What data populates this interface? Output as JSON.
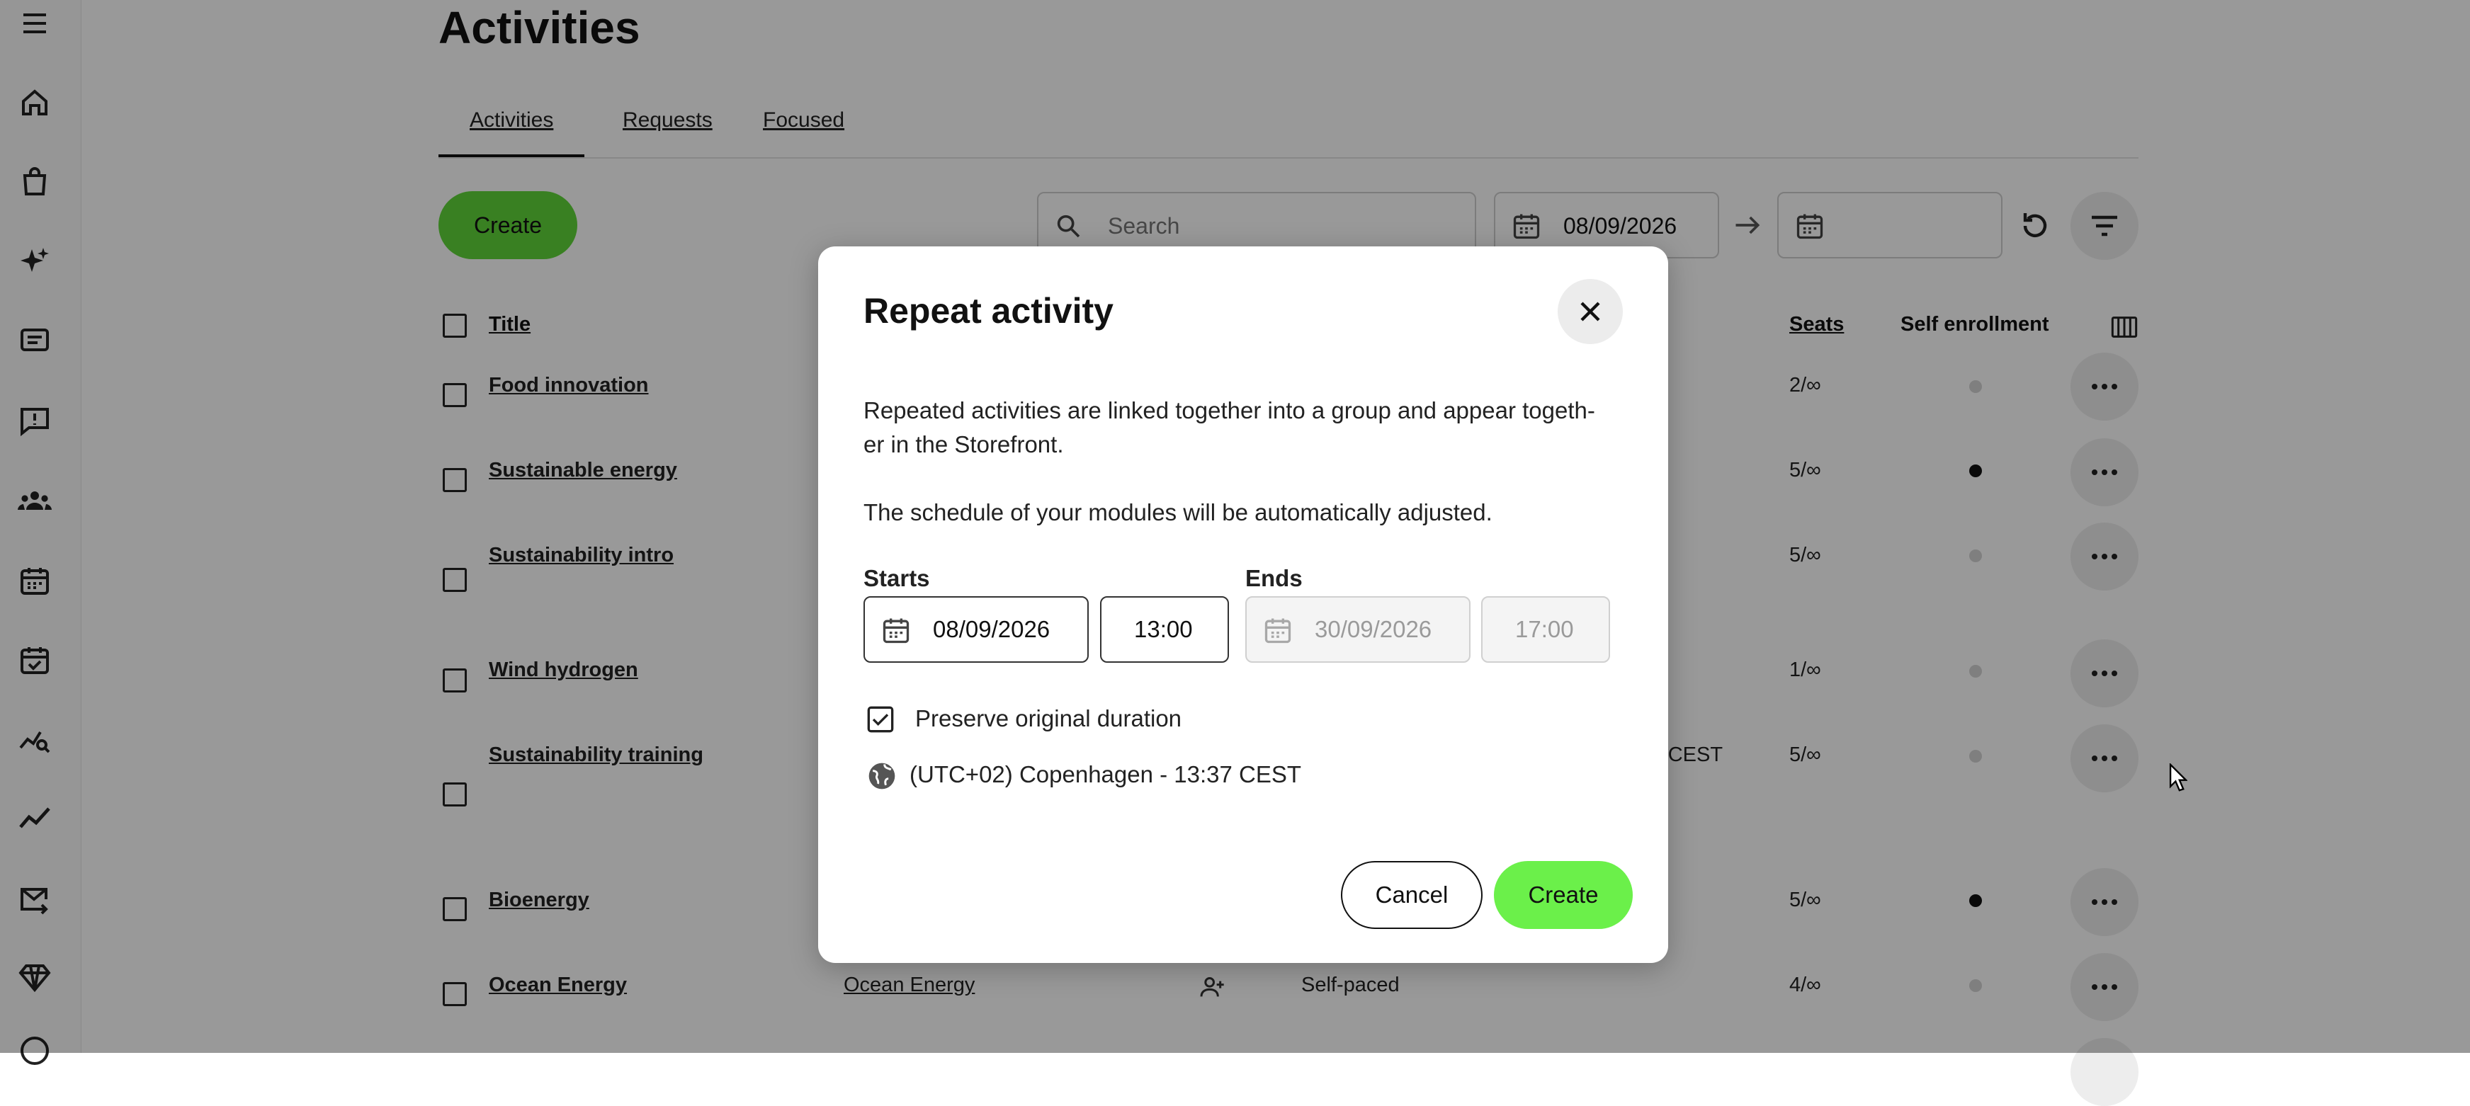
{
  "page": {
    "title": "Activities",
    "tabs": [
      {
        "label": "Activities",
        "active": true
      },
      {
        "label": "Requests",
        "active": false
      },
      {
        "label": "Focused",
        "active": false
      }
    ],
    "create_label": "Create",
    "search_placeholder": "Search",
    "date_from": "08/09/2026",
    "date_to": ""
  },
  "table": {
    "headers": {
      "title": "Title",
      "seats": "Seats",
      "self_enrollment": "Self enrollment"
    },
    "rows": [
      {
        "title": "Food innovation",
        "seats": "2/∞",
        "self_enrollment": false
      },
      {
        "title": "Sustainable energy",
        "seats": "5/∞",
        "self_enrollment": true
      },
      {
        "title": "Sustainability intro",
        "seats": "5/∞",
        "self_enrollment": false
      },
      {
        "title": "Wind hydrogen",
        "seats": "1/∞",
        "self_enrollment": false
      },
      {
        "title": "Sustainability training",
        "seats": "5/∞",
        "self_enrollment": false,
        "partial_text": ") CEST"
      },
      {
        "title": "Bioenergy",
        "seats": "5/∞",
        "self_enrollment": true
      },
      {
        "title": "Ocean Energy",
        "seats": "4/∞",
        "self_enrollment": false,
        "course": "Ocean Energy",
        "type": "Self-paced"
      }
    ]
  },
  "dialog": {
    "title": "Repeat activity",
    "description_1": "Repeated activities are linked together into a group and appear togeth-",
    "description_1b": "er in the Storefront.",
    "description_2": "The schedule of your modules will be automatically adjusted.",
    "starts_label": "Starts",
    "starts_date": "08/09/2026",
    "starts_time": "13:00",
    "ends_label": "Ends",
    "ends_date": "30/09/2026",
    "ends_time": "17:00",
    "preserve_label": "Preserve original duration",
    "preserve_checked": true,
    "timezone": "(UTC+02) Copenhagen - 13:37 CEST",
    "cancel_label": "Cancel",
    "create_label": "Create"
  },
  "colors": {
    "create_green": "#5fd63a",
    "dialog_create_green": "#6bf04a",
    "overlay": "rgba(0,0,0,0.40)"
  },
  "icons": {
    "rail": [
      "menu-icon",
      "home-icon",
      "shopping-bag-icon",
      "sparkles-icon",
      "message-icon",
      "feedback-icon",
      "people-icon",
      "calendar-icon",
      "calendar-check-icon",
      "analytics-search-icon",
      "trend-icon",
      "mail-icon",
      "diamond-icon",
      "help-icon"
    ]
  }
}
